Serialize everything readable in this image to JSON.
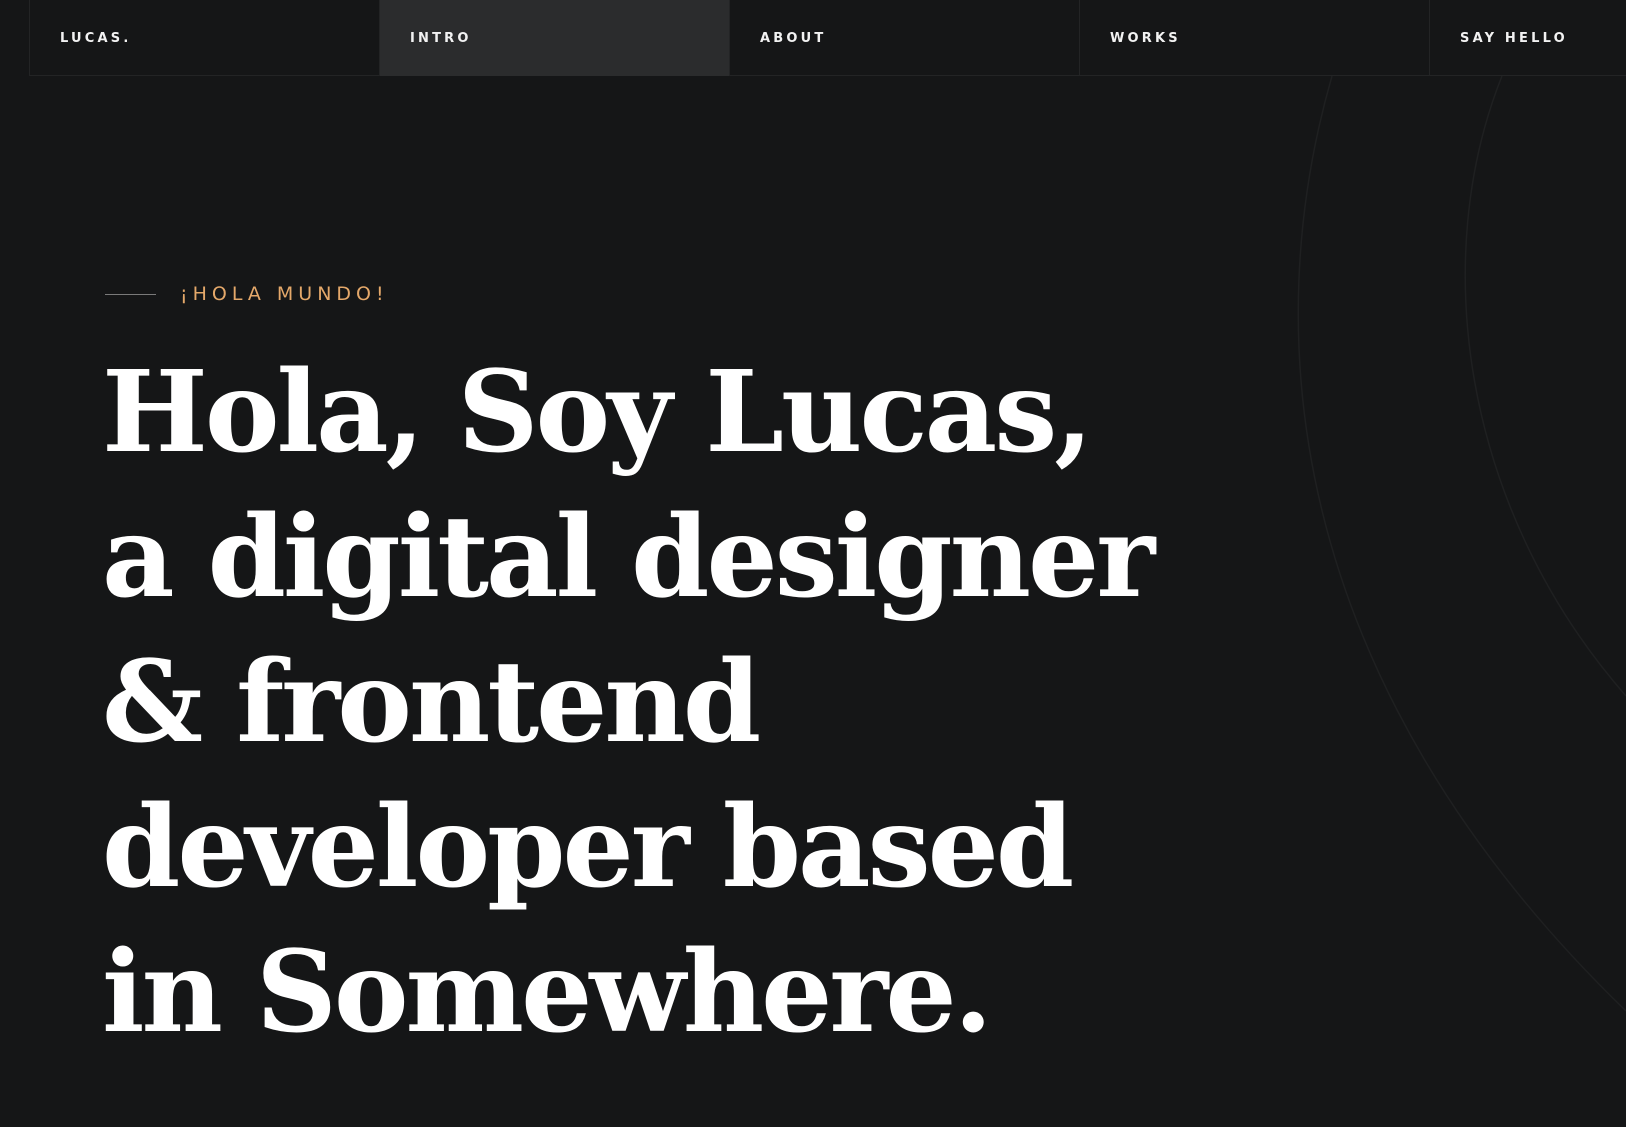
{
  "nav": {
    "brand": "LUCAS.",
    "items": [
      {
        "label": "INTRO",
        "active": true
      },
      {
        "label": "ABOUT",
        "active": false
      },
      {
        "label": "WORKS",
        "active": false
      },
      {
        "label": "SAY HELLO",
        "active": false
      }
    ]
  },
  "hero": {
    "eyebrow": "¡HOLA MUNDO!",
    "headline_lines": [
      "Hola, Soy Lucas,",
      "a digital designer",
      "& frontend",
      "developer based",
      "in Somewhere."
    ]
  },
  "colors": {
    "background": "#151617",
    "active_tab": "#2b2c2d",
    "accent": "#e4a86a",
    "text": "#ffffff",
    "border": "#232425"
  }
}
